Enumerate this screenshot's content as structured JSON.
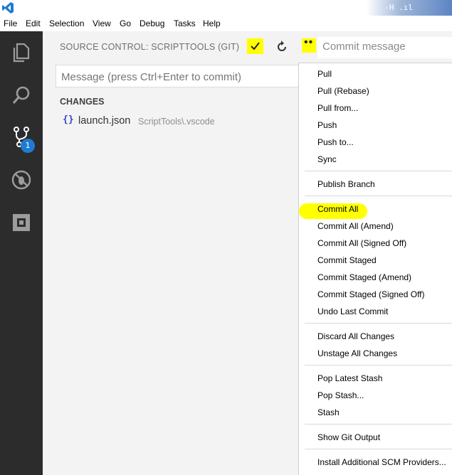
{
  "menubar": {
    "items": [
      "File",
      "Edit",
      "Selection",
      "View",
      "Go",
      "Debug",
      "Tasks",
      "Help"
    ]
  },
  "tray": {
    "text": "-H  .ıl"
  },
  "activity": {
    "scm_badge": "1"
  },
  "sidebar": {
    "title": "SOURCE CONTROL: SCRIPTTOOLS (GIT)",
    "more_label": "••",
    "commit_message_placeholder": "Commit message",
    "message_placeholder": "Message (press Ctrl+Enter to commit)",
    "changes_header": "CHANGES",
    "file": {
      "icon": "{}",
      "name": "launch.json",
      "path": "ScriptTools\\.vscode"
    }
  },
  "menu": {
    "items": [
      "Pull",
      "Pull (Rebase)",
      "Pull from...",
      "Push",
      "Push to...",
      "Sync",
      "Publish Branch",
      "Commit All",
      "Commit All (Amend)",
      "Commit All (Signed Off)",
      "Commit Staged",
      "Commit Staged (Amend)",
      "Commit Staged (Signed Off)",
      "Undo Last Commit",
      "Discard All Changes",
      "Unstage All Changes",
      "Pop Latest Stash",
      "Pop Stash...",
      "Stash",
      "Show Git Output",
      "Install Additional SCM Providers..."
    ]
  },
  "colors": {
    "activity_bar": "#2c2c2c",
    "sidebar": "#f3f3f3",
    "highlight": "#ffff00",
    "badge": "#1e7bd3"
  }
}
